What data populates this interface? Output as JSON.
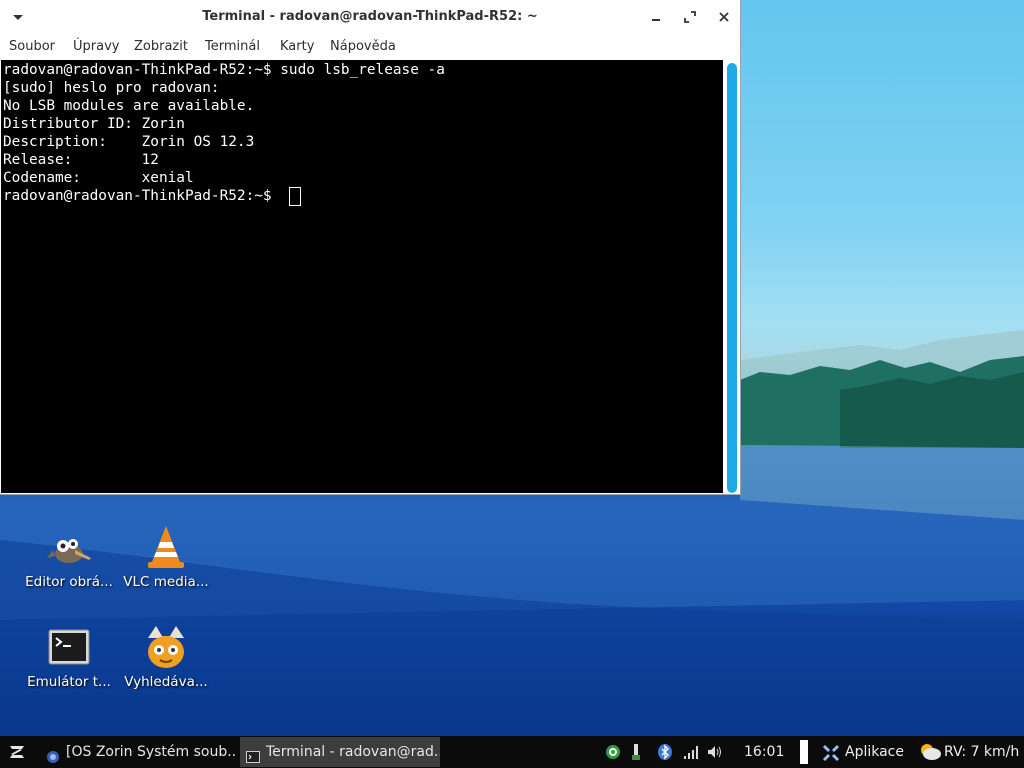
{
  "window": {
    "title": "Terminal - radovan@radovan-ThinkPad-R52: ~",
    "menu": [
      "Soubor",
      "Úpravy",
      "Zobrazit",
      "Terminál",
      "Karty",
      "Nápověda"
    ]
  },
  "terminal": {
    "lines": [
      "radovan@radovan-ThinkPad-R52:~$ sudo lsb_release -a",
      "[sudo] heslo pro radovan:",
      "No LSB modules are available.",
      "Distributor ID: Zorin",
      "Description:    Zorin OS 12.3",
      "Release:        12",
      "Codename:       xenial",
      "radovan@radovan-ThinkPad-R52:~$ "
    ]
  },
  "desktop_icons": [
    {
      "label": "Editor obrá...",
      "icon": "gimp-icon"
    },
    {
      "label": "VLC media...",
      "icon": "vlc-icon"
    },
    {
      "label": "Emulátor t...",
      "icon": "terminal-icon"
    },
    {
      "label": "Vyhledáva...",
      "icon": "catfish-search-icon"
    }
  ],
  "taskbar": {
    "tasks": [
      {
        "label": "[OS Zorin Systém soub...",
        "icon": "browser-icon",
        "active": false
      },
      {
        "label": "Terminal - radovan@rad...",
        "icon": "terminal-icon",
        "active": true
      }
    ],
    "clock": "16:01",
    "apps_label": "Aplikace",
    "weather": "RV: 7 km/h"
  },
  "colors": {
    "accent": "#1fa9e6",
    "terminal_bg": "#000000",
    "terminal_fg": "#ffffff",
    "taskbar_bg": "#0b0b0b"
  }
}
